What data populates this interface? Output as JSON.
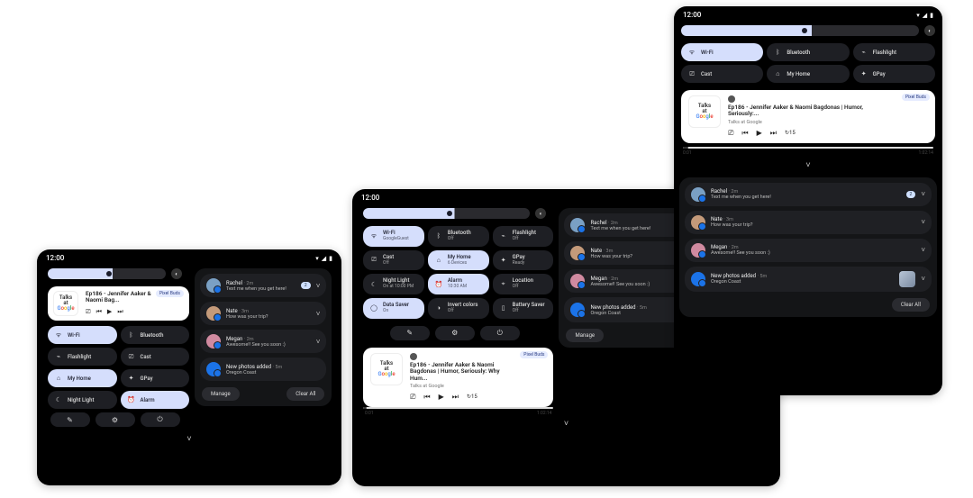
{
  "status": {
    "time": "12:00"
  },
  "qs": {
    "wifi": "Wi-Fi",
    "wifi_sub": "GoogleGuest",
    "bluetooth": "Bluetooth",
    "flashlight": "Flashlight",
    "cast": "Cast",
    "myhome": "My Home",
    "myhome_sub": "6 Devices",
    "gpay": "GPay",
    "gpay_sub": "Ready",
    "nightlight": "Night Light",
    "nightlight_sub": "On at 10:00 PM",
    "alarm": "Alarm",
    "alarm_sub": "10:30 AM",
    "location": "Location",
    "datasaver": "Data Saver",
    "datasaver_sub": "On",
    "invert": "Invert colors",
    "battery": "Battery Saver",
    "off": "Off",
    "on": "On"
  },
  "media": {
    "art_line1": "Talks",
    "art_line2": "at",
    "title_short": "Ep186 - Jennifer Aaker & Naomi Bag...",
    "title_med": "Ep186 - Jennifer Aaker & Naomi Bagdonas | Humor, Seriously: Why Hum...",
    "title_long": "Ep186 - Jennifer Aaker & Naomi Bagdonas | Humor, Seriously:...",
    "subtitle": "Talks at Google",
    "badge": "Pixel Buds",
    "t0": "0:01",
    "t1": "1:02:14"
  },
  "notif": {
    "rachel": "Rachel",
    "rachel_msg": "Text me when you get here!",
    "rachel_time": "2m",
    "nate": "Nate",
    "nate_msg": "How was your trip?",
    "nate_time": "3m",
    "megan": "Megan",
    "megan_msg": "Awesome!! See you soon :)",
    "megan_time": "2m",
    "photos": "New photos added",
    "photos_sub": "Oregon Coast",
    "photos_time": "5m",
    "badge": "2",
    "manage": "Manage",
    "clear": "Clear All"
  }
}
